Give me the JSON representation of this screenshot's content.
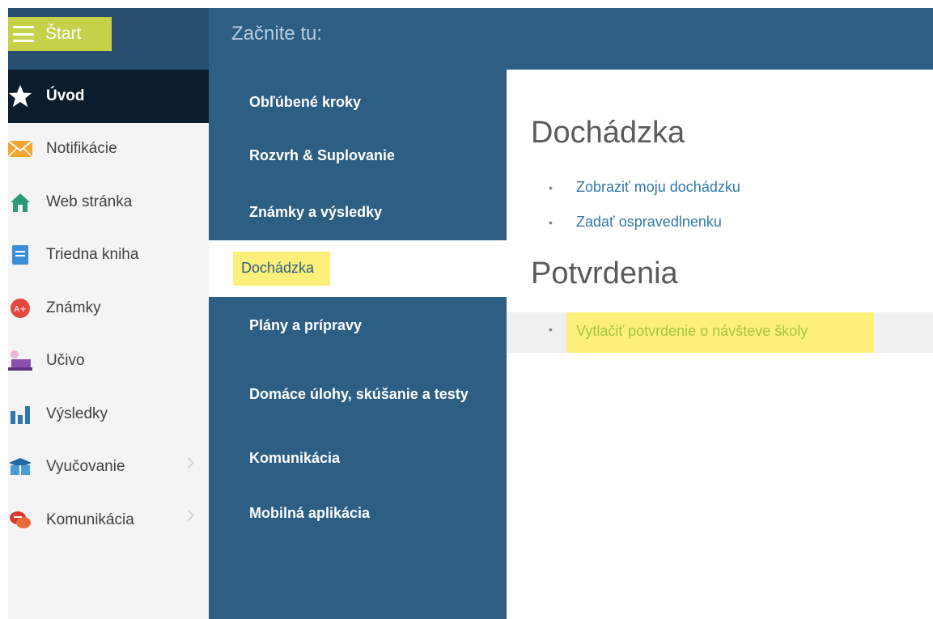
{
  "topbar": {
    "start_label": "Štart",
    "title": "Začnite tu:"
  },
  "sidebar": {
    "items": [
      {
        "label": "Úvod",
        "icon": "star-icon"
      },
      {
        "label": "Notifikácie",
        "icon": "envelope-icon"
      },
      {
        "label": "Web stránka",
        "icon": "house-icon"
      },
      {
        "label": "Triedna kniha",
        "icon": "book-icon"
      },
      {
        "label": "Známky",
        "icon": "grade-icon"
      },
      {
        "label": "Učivo",
        "icon": "lesson-icon"
      },
      {
        "label": "Výsledky",
        "icon": "bar-chart-icon"
      },
      {
        "label": "Vyučovanie",
        "icon": "open-book-icon"
      },
      {
        "label": "Komunikácia",
        "icon": "chat-icon"
      }
    ]
  },
  "menu": {
    "items": [
      "Obľúbené kroky",
      "Rozvrh & Suplovanie",
      "Známky a výsledky",
      "Dochádzka",
      "Plány a prípravy",
      "Domáce úlohy, skúšanie a testy",
      "Komunikácia",
      "Mobilná aplikácia"
    ]
  },
  "content": {
    "section1_title": "Dochádzka",
    "section1_links": [
      "Zobraziť moju dochádzku",
      "Zadať ospravedlnenku"
    ],
    "section2_title": "Potvrdenia",
    "section2_links": [
      "Vytlačiť potvrdenie o návšteve školy"
    ]
  },
  "colors": {
    "accent_yellow": "#fcf07a",
    "start_green": "#c6d14a",
    "menu_blue": "#2d5e84",
    "active_dark": "#0b1c2c",
    "link_blue": "#2f78a8"
  }
}
